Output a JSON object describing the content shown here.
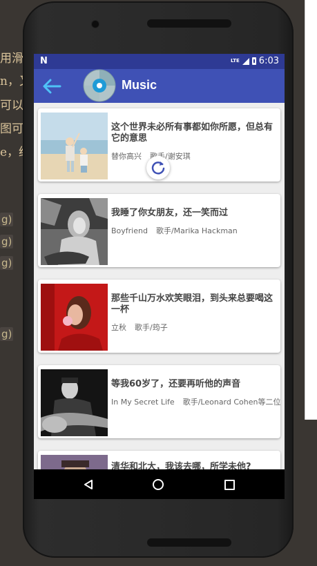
{
  "background": {
    "lines": [
      "用滑",
      "n，又",
      "可以",
      "图可",
      "e，经"
    ],
    "parens": [
      "g)",
      "g)",
      "g)",
      "g)"
    ]
  },
  "status_bar": {
    "notification_icon": "N",
    "network": "LTE",
    "time": "6:03"
  },
  "app_bar": {
    "title": "Music",
    "back_icon": "arrow-back-icon",
    "logo_icon": "cd-disc-icon"
  },
  "songs": [
    {
      "title": "这个世界未必所有事都如你所愿，但总有它的意思",
      "album": "替你高兴",
      "singer": "歌手/谢安琪",
      "thumb": "beach-children"
    },
    {
      "title": "我睡了你女朋友，还一笑而过",
      "album": "Boyfriend",
      "singer": "歌手/Marika Hackman",
      "thumb": "bw-guitar-girl"
    },
    {
      "title": "那些千山万水欢笑眼泪，到头来总要喝这一杯",
      "album": "立秋",
      "singer": "歌手/筠子",
      "thumb": "red-bubblegum"
    },
    {
      "title": "等我60岁了，还要再听他的声音",
      "album": "In My Secret Life",
      "singer": "歌手/Leonard Cohen等二位",
      "thumb": "bw-man-guitar"
    },
    {
      "title": "清华和北大，我该去哪，所学未他?",
      "album": "",
      "singer": "",
      "thumb": "portrait"
    }
  ],
  "colors": {
    "primary": "#3f51b5",
    "primary_dark": "#2e3a94",
    "accent": "#3f51b5"
  }
}
